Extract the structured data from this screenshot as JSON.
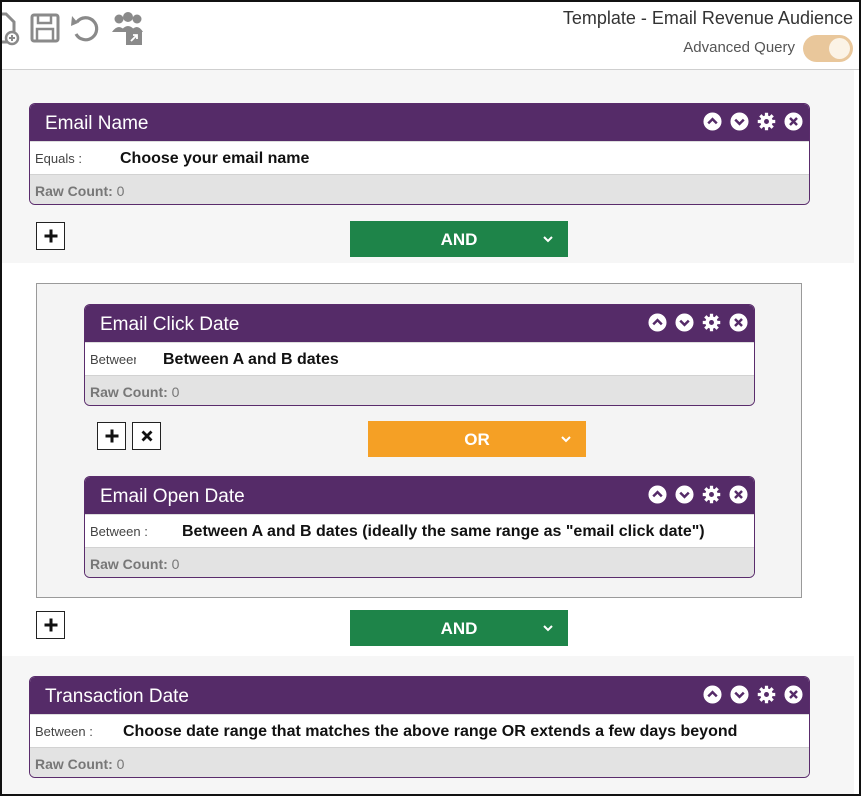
{
  "toolbar": {
    "title": "Template - Email Revenue Audience",
    "advanced_query_label": "Advanced Query",
    "advanced_query_on": true,
    "icons": [
      "new-document-icon",
      "save-icon",
      "undo-icon",
      "share-audience-icon"
    ]
  },
  "colors": {
    "card_header": "#552b68",
    "and_operator": "#1e8449",
    "or_operator": "#f5a025",
    "toggle_on": "#e9c79b"
  },
  "rules": [
    {
      "title": "Email Name",
      "operator": "Equals :",
      "value": "Choose your email name",
      "raw_count_label": "Raw Count:",
      "raw_count": "0"
    },
    {
      "title": "Email Click Date",
      "operator": "Between :",
      "value": "Between A and B dates",
      "raw_count_label": "Raw Count:",
      "raw_count": "0"
    },
    {
      "title": "Email Open Date",
      "operator": "Between :",
      "value": "Between A and B dates (ideally the same range as \"email click date\")",
      "raw_count_label": "Raw Count:",
      "raw_count": "0"
    },
    {
      "title": "Transaction Date",
      "operator": "Between :",
      "value": "Choose date range that matches the above range OR extends a few days beyond",
      "raw_count_label": "Raw Count:",
      "raw_count": "0"
    }
  ],
  "operators": {
    "and_1": "AND",
    "or_1": "OR",
    "and_2": "AND"
  }
}
